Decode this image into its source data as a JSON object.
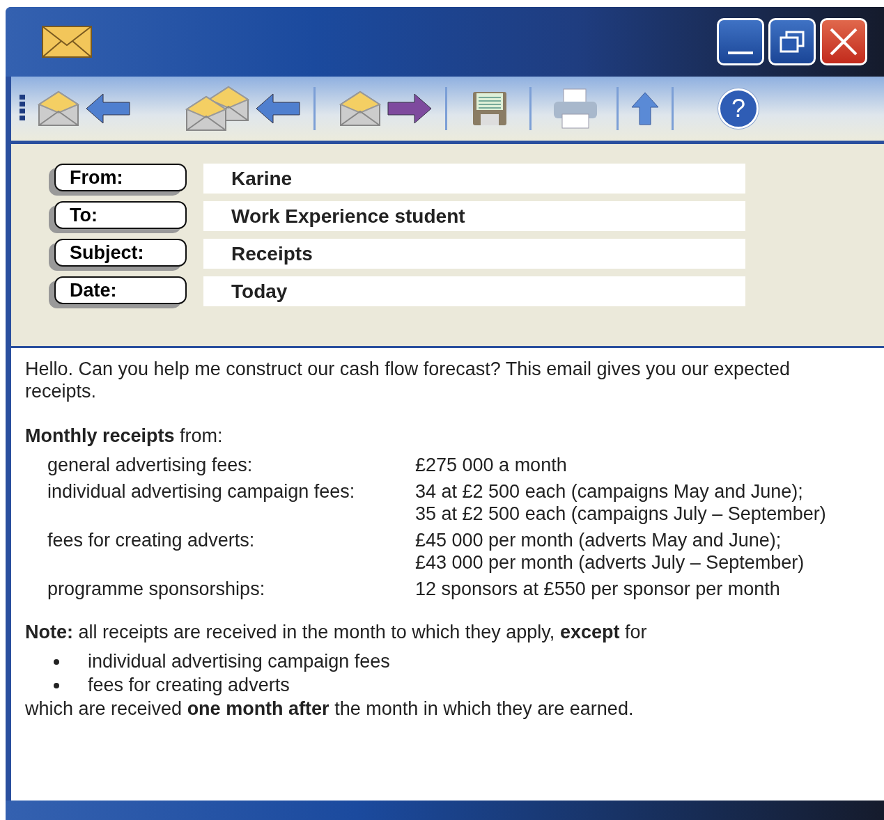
{
  "header_fields": [
    {
      "label": "From:",
      "value": "Karine"
    },
    {
      "label": "To:",
      "value": "Work Experience student"
    },
    {
      "label": "Subject:",
      "value": "Receipts"
    },
    {
      "label": "Date:",
      "value": "Today"
    }
  ],
  "toolbar": {
    "help_label": "?"
  },
  "message": {
    "intro": "Hello. Can you help me construct our cash flow forecast? This email gives you our expected receipts.",
    "receipts_heading": "**Monthly receipts** from:",
    "receipts": [
      {
        "label": "general advertising fees:",
        "values": [
          "£275 000 a month"
        ]
      },
      {
        "label": "individual advertising campaign fees:",
        "values": [
          "34 at £2 500 each (campaigns May and June);",
          "35 at £2 500 each (campaigns July – September)"
        ]
      },
      {
        "label": "fees for creating adverts:",
        "values": [
          "£45 000 per month (adverts May and June);",
          "£43 000 per month (adverts July – September)"
        ]
      },
      {
        "label": "programme sponsorships:",
        "values": [
          "12 sponsors at £550 per sponsor per month"
        ]
      }
    ],
    "note": "**Note:** all receipts are received in the month to which they apply, **except** for",
    "bullets": [
      "individual advertising campaign fees",
      "fees for creating adverts"
    ],
    "closing": "which are received **one month after** the month in which they are earned."
  }
}
